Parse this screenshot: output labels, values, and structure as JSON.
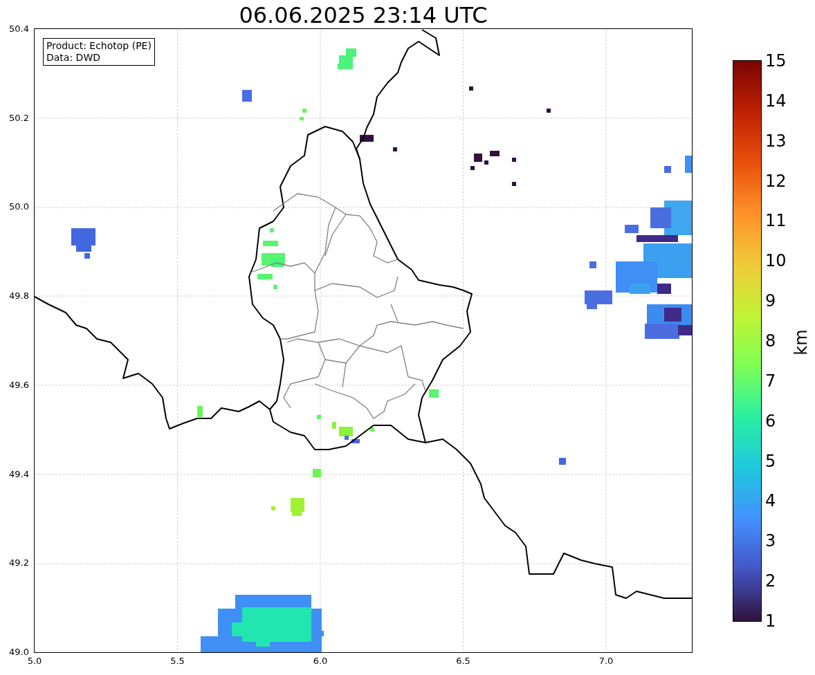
{
  "title": "06.06.2025 23:14 UTC",
  "info_box": [
    "Product: Echotop (PE)",
    "Data: DWD"
  ],
  "x_ticks": [
    "5.0",
    "5.5",
    "6.0",
    "6.5",
    "7.0"
  ],
  "y_ticks": [
    "50.4",
    "50.2",
    "50.0",
    "49.8",
    "49.6",
    "49.4",
    "49.2",
    "49.0"
  ],
  "colorbar": {
    "label": "km",
    "ticks": [
      "15",
      "14",
      "13",
      "12",
      "11",
      "10",
      "9",
      "8",
      "7",
      "6",
      "5",
      "4",
      "3",
      "2",
      "1"
    ]
  }
}
